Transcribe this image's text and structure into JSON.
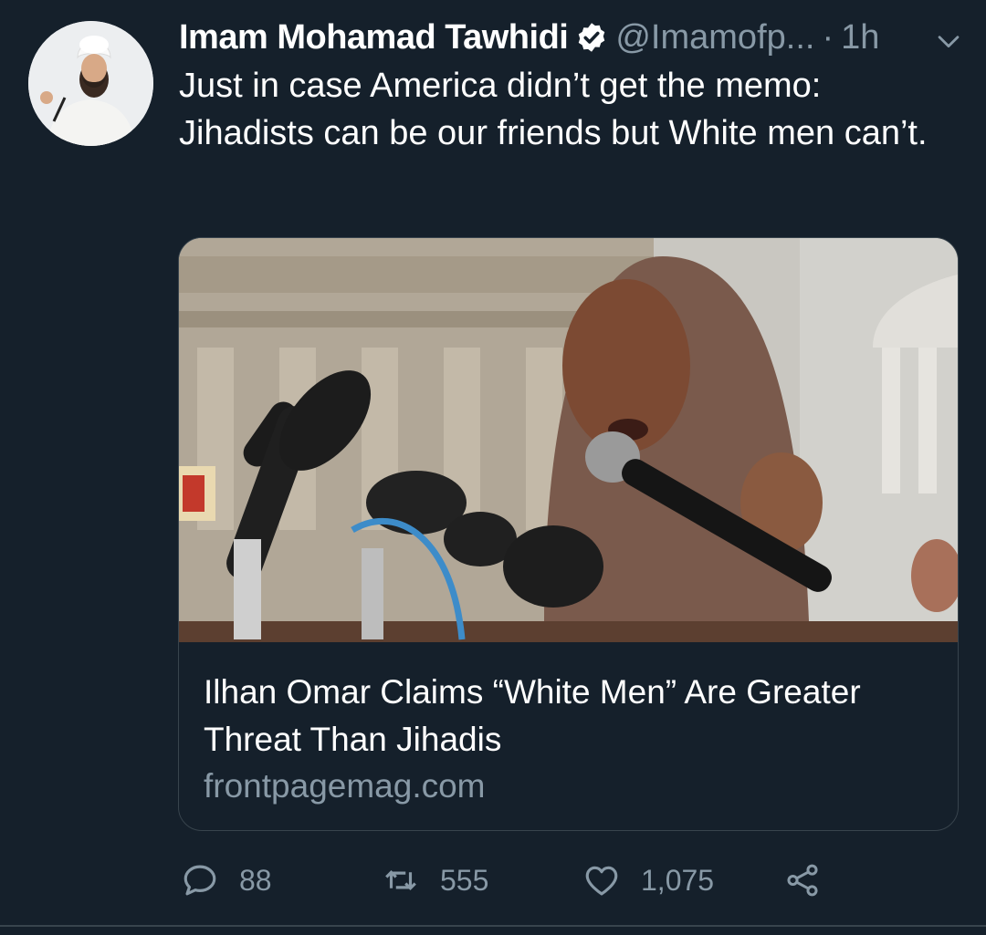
{
  "tweet": {
    "display_name": "Imam Mohamad Tawhidi",
    "handle": "@Imamofp...",
    "separator": "·",
    "timestamp": "1h",
    "text": "Just in case America didn’t get the memo: Jihadists can be our friends but White men can’t."
  },
  "card": {
    "title": "Ilhan Omar Claims “White Men” Are Greater Threat Than Jihadis",
    "domain": "frontpagemag.com"
  },
  "actions": {
    "replies": "88",
    "retweets": "555",
    "likes": "1,075"
  },
  "icons": {
    "verified": "verified-badge-icon",
    "chevron": "chevron-down-icon",
    "reply": "reply-icon",
    "retweet": "retweet-icon",
    "like": "heart-icon",
    "share": "share-icon"
  },
  "colors": {
    "background": "#15202b",
    "text_primary": "#ffffff",
    "text_secondary": "#8899a6",
    "border": "#38444d"
  }
}
